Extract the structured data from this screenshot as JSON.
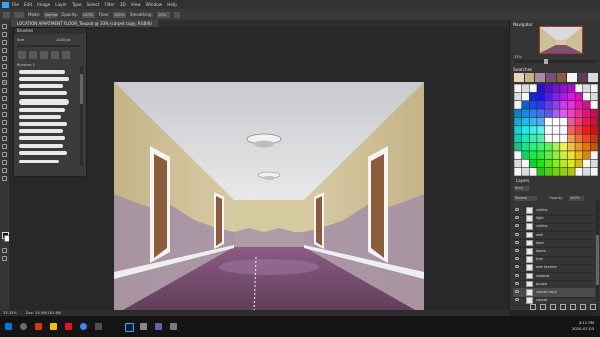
{
  "app": {
    "title": "Photoshop"
  },
  "menu": [
    "File",
    "Edit",
    "Image",
    "Layer",
    "Type",
    "Select",
    "Filter",
    "3D",
    "View",
    "Window",
    "Help"
  ],
  "options_bar": {
    "mode_label": "Mode:",
    "mode_value": "Normal",
    "opacity_label": "Opacity:",
    "opacity_value": "100%",
    "flow_label": "Flow:",
    "flow_value": "100%",
    "smoothing_label": "Smoothing:",
    "smoothing_value": "10%"
  },
  "document_tab": {
    "label": "LOCATION APARTMENT FLOOR_Teopod @ 33% (carpet copy, RGB/8)"
  },
  "brush_panel": {
    "title": "Brushes",
    "size_label": "Size",
    "size_value": "1000 px",
    "group_label": "Brushes 1"
  },
  "navigator": {
    "title": "Navigator",
    "zoom": "33%"
  },
  "swatches": {
    "title": "Swatches",
    "colors": [
      "#e8d5b5",
      "#d4bfa0",
      "#b9a07f",
      "#9a8060",
      "#7a6045",
      "#5a4530",
      "#ffffff",
      "#f0f0f0",
      "#d0d0d0",
      "#b0b0b0",
      "#909090",
      "#707070",
      "#505050",
      "#303030",
      "#101010",
      "#000000",
      "#ff0000",
      "#ff8000",
      "#ffff00",
      "#80ff00",
      "#00ff00",
      "#00ff80",
      "#00ffff",
      "#0080ff",
      "#0000ff",
      "#8000ff",
      "#ff00ff",
      "#ff0080",
      "#c00000",
      "#c06000",
      "#c0c000",
      "#60c000",
      "#00c000",
      "#00c060",
      "#00c0c0",
      "#0060c0",
      "#0000c0",
      "#6000c0",
      "#c000c0",
      "#c00060",
      "#800000",
      "#804000",
      "#808000",
      "#408000",
      "#008000",
      "#008040",
      "#008080",
      "#004080",
      "#000080",
      "#400080",
      "#800080",
      "#800040"
    ]
  },
  "layers": {
    "title": "Layers",
    "kind_label": "Kind",
    "blend": "Normal",
    "opacity_label": "Opacity:",
    "opacity_value": "100%",
    "items": [
      {
        "name": "ceiling"
      },
      {
        "name": "light"
      },
      {
        "name": "ceiling"
      },
      {
        "name": "wall"
      },
      {
        "name": "door"
      },
      {
        "name": "doors"
      },
      {
        "name": "trim"
      },
      {
        "name": "wall texture"
      },
      {
        "name": "shadow"
      },
      {
        "name": "purple"
      },
      {
        "name": "carpet copy"
      },
      {
        "name": "carpet"
      }
    ]
  },
  "status": {
    "zoom": "33.33%",
    "doc": "Doc: 24.9M/161.6M"
  },
  "tray": {
    "time": "4:11 PM",
    "date": "2020-07-03"
  },
  "colors": {
    "wall": "#c8b98d",
    "ceiling": "#d9dadd",
    "floor": "#7a4f72",
    "door": "#8c5f3e",
    "trim": "#f2f2f2",
    "wainscot": "#a08aa0"
  }
}
